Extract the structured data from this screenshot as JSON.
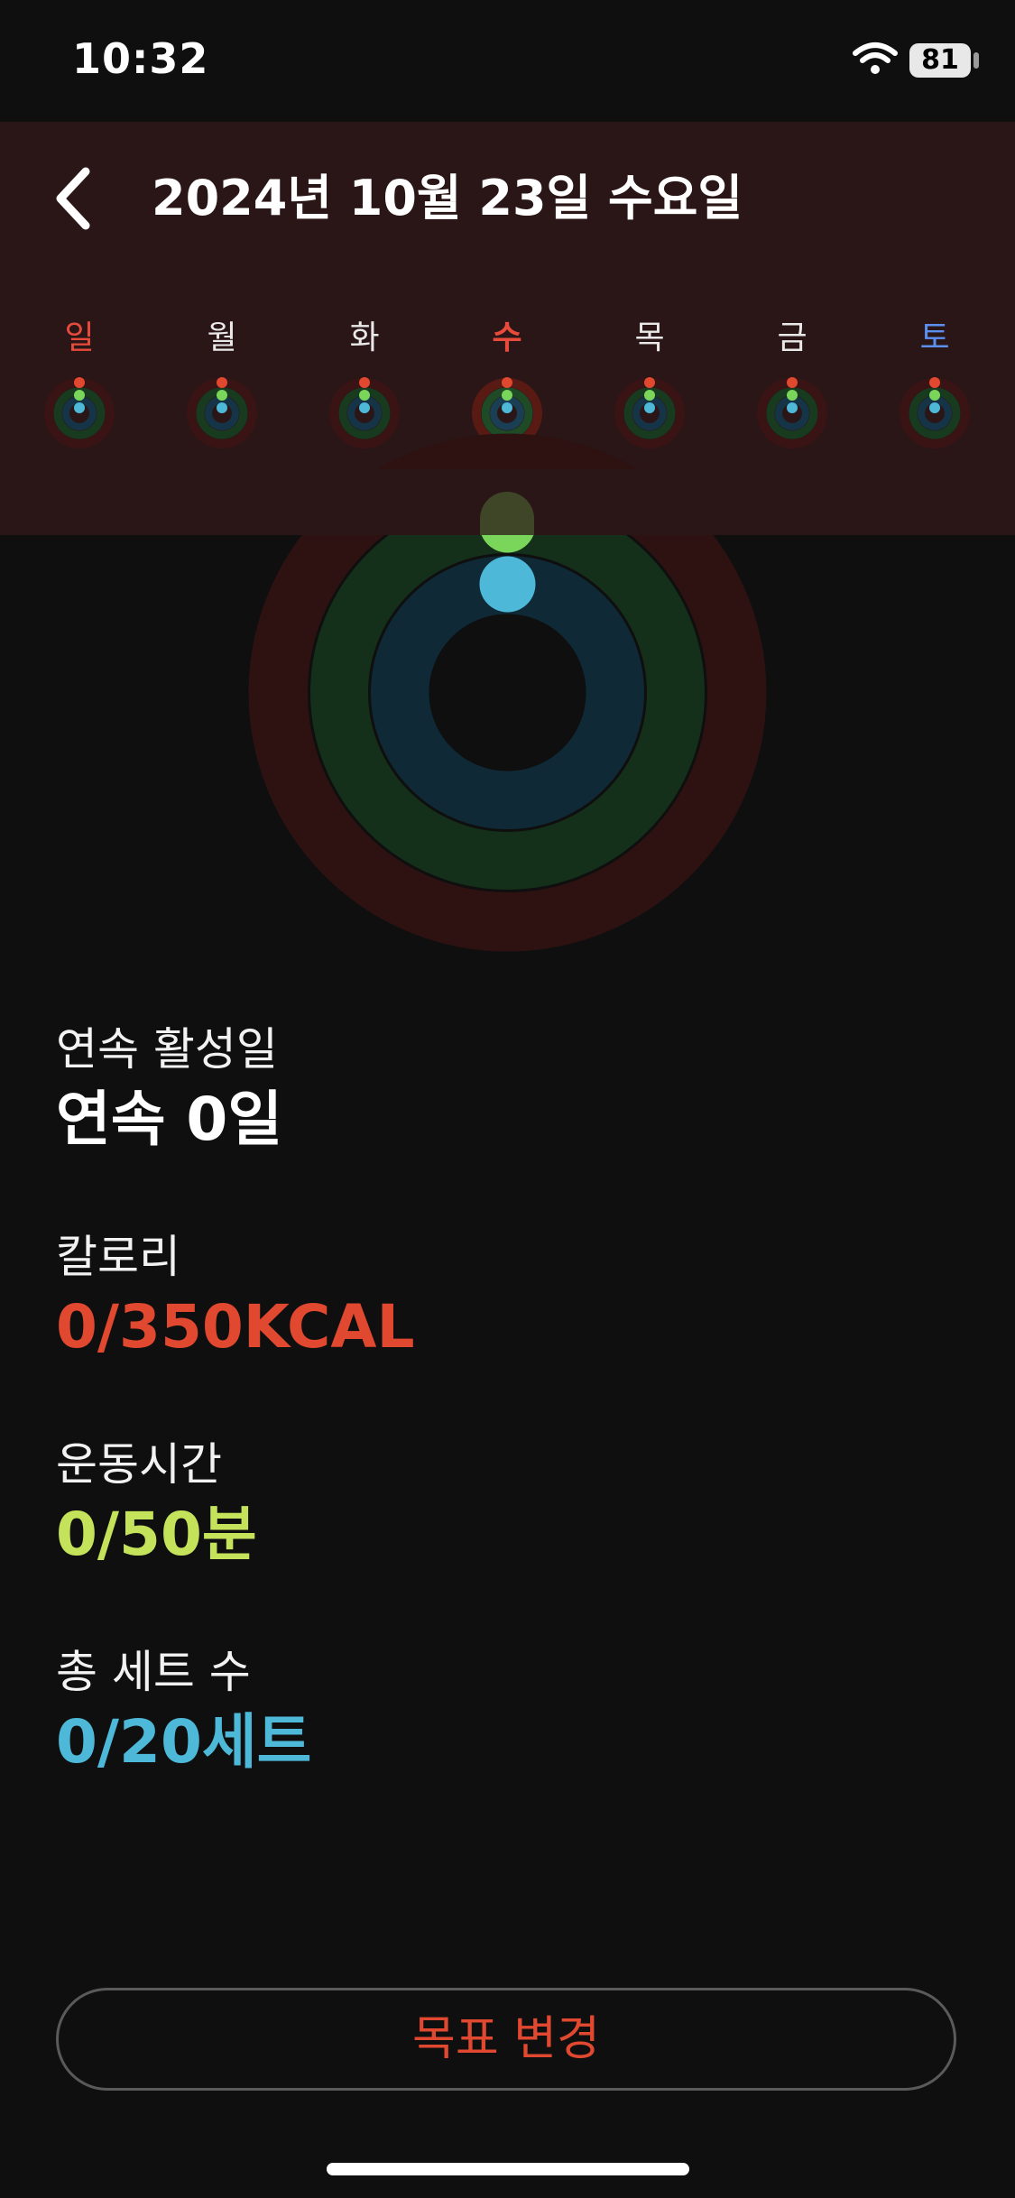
{
  "status_bar": {
    "time": "10:32",
    "battery": "81"
  },
  "header": {
    "title": "2024년 10월 23일 수요일"
  },
  "week": {
    "days": [
      {
        "label": "일",
        "type": "sun"
      },
      {
        "label": "월",
        "type": "normal"
      },
      {
        "label": "화",
        "type": "normal"
      },
      {
        "label": "수",
        "type": "today"
      },
      {
        "label": "목",
        "type": "normal"
      },
      {
        "label": "금",
        "type": "normal"
      },
      {
        "label": "토",
        "type": "sat"
      }
    ]
  },
  "rings": {
    "move_progress": 0,
    "exercise_progress": 0,
    "sets_progress": 0,
    "colors": {
      "move": "#e0482f",
      "exercise": "#7ad65a",
      "sets": "#4db8d8"
    }
  },
  "stats": {
    "streak": {
      "label": "연속 활성일",
      "value": "연속 0일",
      "color": "#ffffff"
    },
    "calories": {
      "label": "칼로리",
      "value": "0/350KCAL",
      "color": "#e0482f"
    },
    "exercise_time": {
      "label": "운동시간",
      "value": "0/50분",
      "color": "#c5e35a"
    },
    "total_sets": {
      "label": "총 세트 수",
      "value": "0/20세트",
      "color": "#4db8d8"
    }
  },
  "goal_button": {
    "label": "목표 변경"
  }
}
